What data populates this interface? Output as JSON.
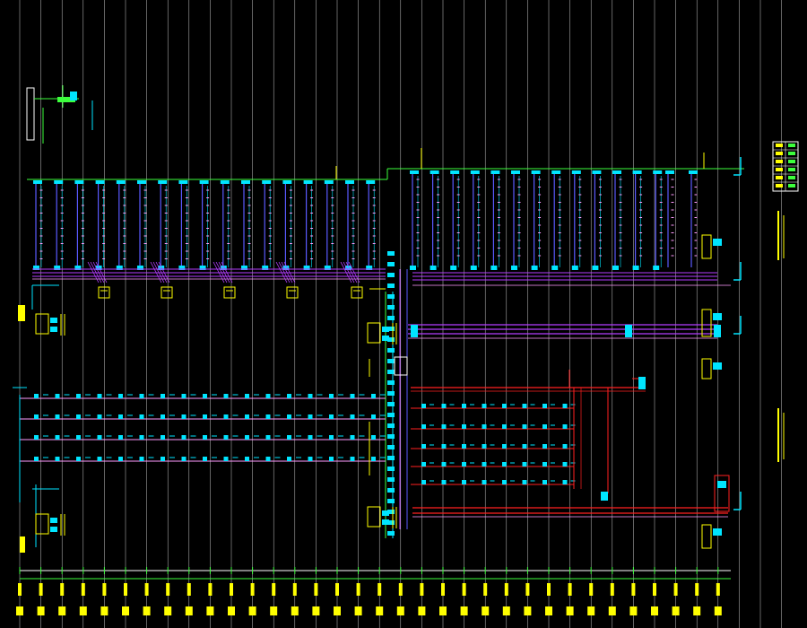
{
  "drawing": {
    "background": "#000000",
    "colors": {
      "grid": "#c8c8c8",
      "pipe_green": "#3cff3c",
      "pipe_purple": "#b43cff",
      "pipe_red": "#ff2020",
      "pipe_pink": "#ff9cff",
      "riser_blue": "#5a5aff",
      "equipment_cyan": "#00e5ff",
      "text_yellow": "#ffff00",
      "frame_white": "#ffffff"
    },
    "axis_count": 37,
    "upper_zone": {
      "left_risers": 17,
      "right_risers": 15,
      "tees_per_riser": 11
    },
    "middle_zone": {
      "header_pipes": 3
    },
    "lower_left_zone": {
      "branch_rows": 4,
      "nodes_per_row": 17
    },
    "lower_right_zone": {
      "branch_rows": 5,
      "nodes_per_row": 8
    }
  }
}
